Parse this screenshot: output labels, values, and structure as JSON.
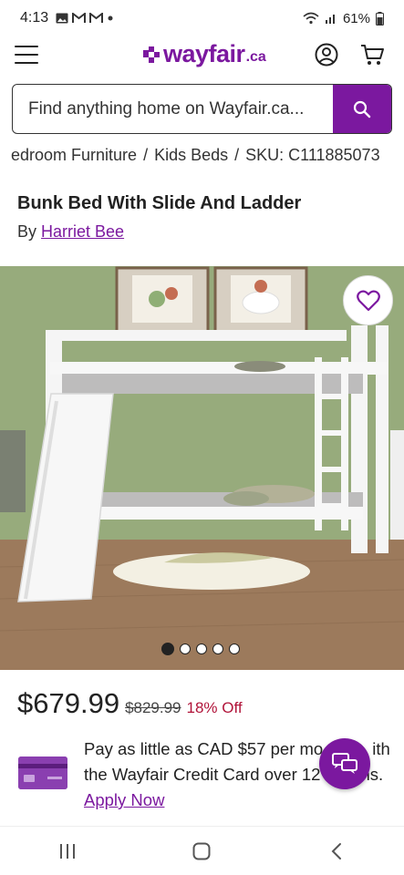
{
  "status_bar": {
    "time": "4:13",
    "battery": "61%",
    "icons": [
      "gallery-icon",
      "gmail-icon",
      "gmail-icon",
      "dot-icon"
    ]
  },
  "header": {
    "logo_text": "wayfair",
    "logo_tld": ".ca",
    "brand_color": "#7b189f"
  },
  "search": {
    "placeholder": "Find anything home on Wayfair.ca..."
  },
  "breadcrumbs": [
    "edroom Furniture",
    "Kids Beds",
    "SKU: C111885073"
  ],
  "breadcrumb_separator": "/",
  "product": {
    "title": "Bunk Bed With Slide And Ladder",
    "by_label": "By",
    "brand": "Harriet Bee",
    "price": "$679.99",
    "old_price": "$829.99",
    "discount": "18% Off"
  },
  "carousel": {
    "active_index": 0,
    "count": 5
  },
  "credit_offer": {
    "line1": "Pay as little as CAD $57 per mo",
    "line1_tail": "ith",
    "line2": "the Wayfair Credit Card over 12",
    "line2_tail": "ns.",
    "apply_label": "Apply Now"
  }
}
